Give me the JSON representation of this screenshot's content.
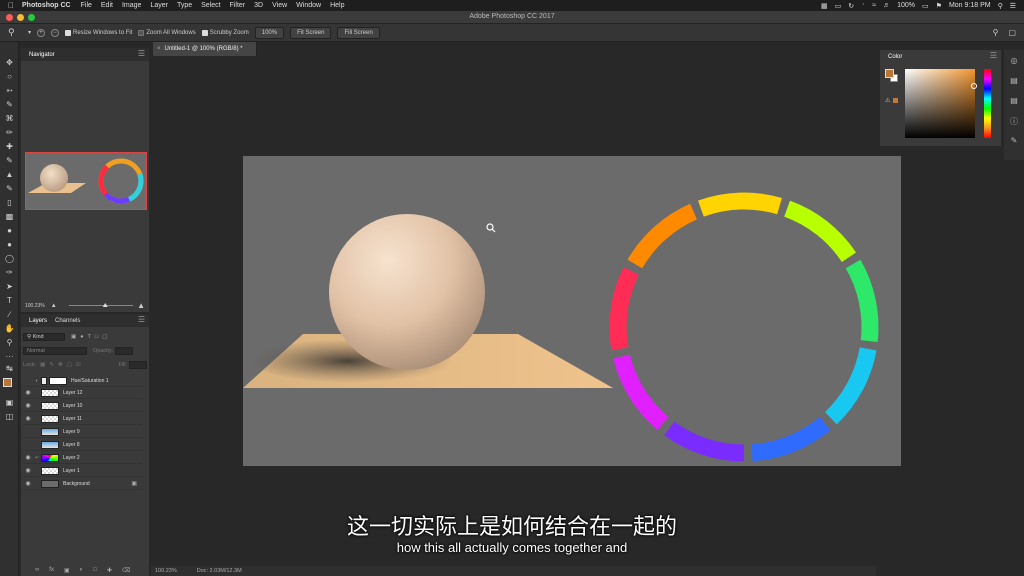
{
  "menubar": {
    "app_name": "Photoshop CC",
    "items": [
      "File",
      "Edit",
      "Image",
      "Layer",
      "Type",
      "Select",
      "Filter",
      "3D",
      "View",
      "Window",
      "Help"
    ],
    "battery": "100%",
    "clock": "Mon 9:18 PM"
  },
  "window": {
    "title": "Adobe Photoshop CC 2017"
  },
  "options": {
    "resize_windows": "Resize Windows to Fit",
    "zoom_all": "Zoom All Windows",
    "scrubby": "Scrubby Zoom",
    "zoom_value": "100%",
    "fit_screen": "Fit Screen",
    "fill_screen": "Fill Screen"
  },
  "navigator": {
    "tab": "Navigator",
    "zoom": "100.23%"
  },
  "layers": {
    "tab_layers": "Layers",
    "tab_channels": "Channels",
    "kind": "Kind",
    "blend": "Normal",
    "opacity_label": "Opacity:",
    "lock_label": "Lock:",
    "fill_label": "Fill:",
    "items": [
      {
        "name": "Hue/Saturation 1"
      },
      {
        "name": "Layer 12"
      },
      {
        "name": "Layer 10"
      },
      {
        "name": "Layer 11"
      },
      {
        "name": "Layer 9"
      },
      {
        "name": "Layer 8"
      },
      {
        "name": "Layer 2"
      },
      {
        "name": "Layer 1"
      },
      {
        "name": "Background"
      }
    ]
  },
  "document": {
    "tab": "Untitled-1 @ 100% (RGB/8) *"
  },
  "color_panel": {
    "tab": "Color",
    "foreground": "#b87637"
  },
  "status": {
    "zoom": "100.23%",
    "doc": "Doc: 2.03M/12.3M"
  },
  "subtitles": {
    "chinese": "这一切实际上是如何结合在一起的",
    "english": "how this all actually comes together and"
  }
}
